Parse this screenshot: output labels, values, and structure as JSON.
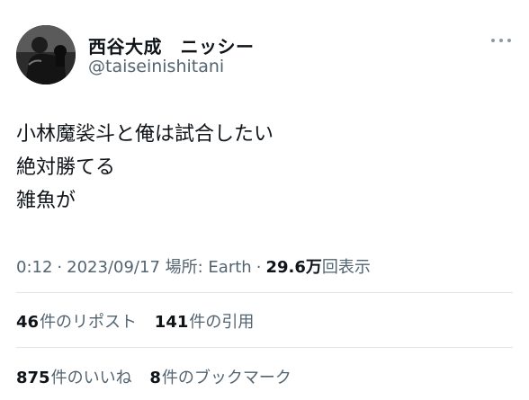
{
  "user": {
    "display_name": "西谷大成　ニッシー",
    "handle": "@taiseinishitani"
  },
  "tweet": {
    "lines": [
      "小林魔裟斗と俺は試合したい",
      "絶対勝てる",
      "雑魚が"
    ]
  },
  "meta": {
    "time": "0:12",
    "date": "2023/09/17",
    "location_label": "場所: Earth",
    "views_count": "29.6万",
    "views_label": "回表示",
    "separator": "·"
  },
  "stats": {
    "reposts": {
      "count": "46",
      "label": "件のリポスト"
    },
    "quotes": {
      "count": "141",
      "label": "件の引用"
    },
    "likes": {
      "count": "875",
      "label": "件のいいね"
    },
    "bookmarks": {
      "count": "8",
      "label": "件のブックマーク"
    }
  },
  "icons": {
    "more": "more-horizontal-icon",
    "avatar": "profile-avatar"
  }
}
